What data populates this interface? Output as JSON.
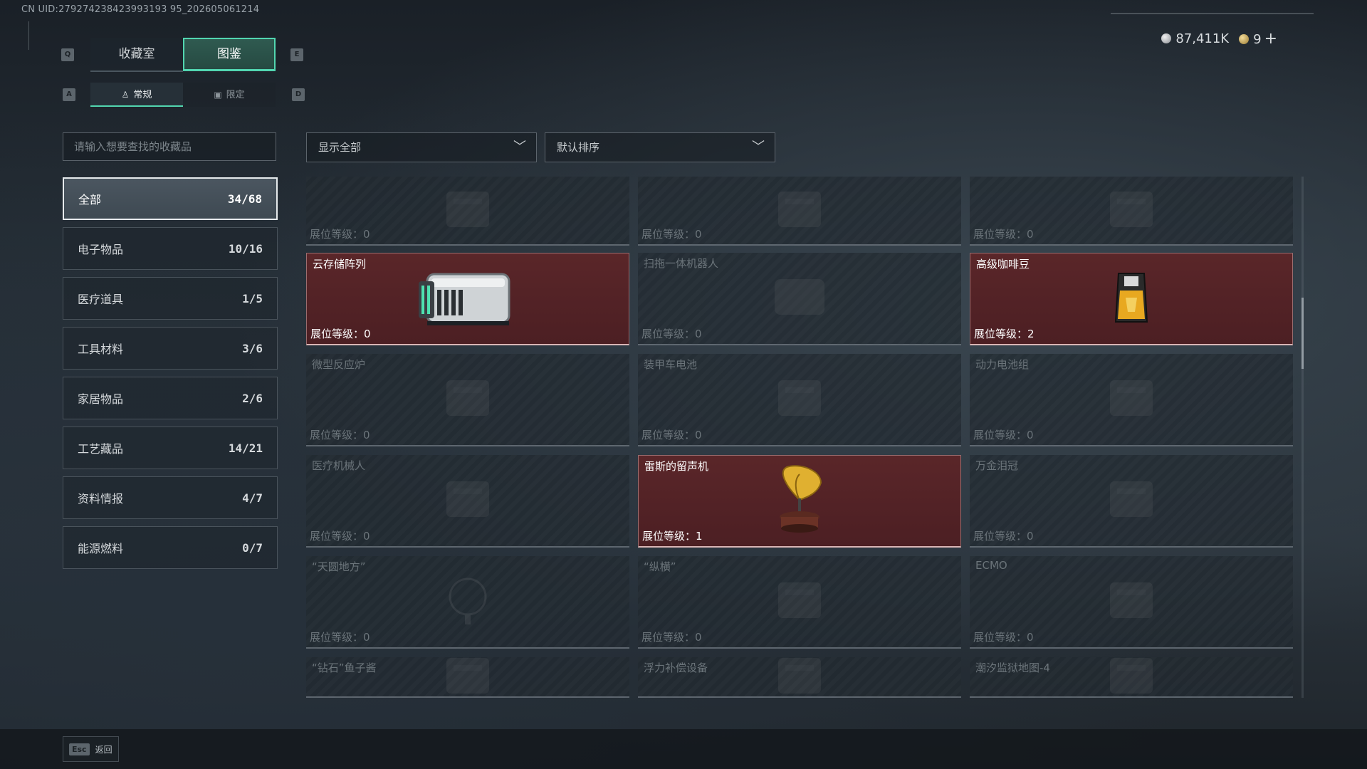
{
  "uid_text": "CN UID:279274238423993193 95_202605061214",
  "currency": {
    "coins": "87,411K",
    "tickets": "9",
    "plus": "+"
  },
  "keys": {
    "prev_tab": "Q",
    "next_tab": "E",
    "prev_sub": "A",
    "next_sub": "D"
  },
  "tabs": [
    {
      "label": "收藏室"
    },
    {
      "label": "图鉴"
    }
  ],
  "subtabs": [
    {
      "label": "常规"
    },
    {
      "label": "限定"
    }
  ],
  "search": {
    "placeholder": "请输入想要查找的收藏品"
  },
  "filters": {
    "show": "显示全部",
    "sort": "默认排序"
  },
  "categories": [
    {
      "label": "全部",
      "count": "34/68"
    },
    {
      "label": "电子物品",
      "count": "10/16"
    },
    {
      "label": "医疗道具",
      "count": "1/5"
    },
    {
      "label": "工具材料",
      "count": "3/6"
    },
    {
      "label": "家居物品",
      "count": "2/6"
    },
    {
      "label": "工艺藏品",
      "count": "14/21"
    },
    {
      "label": "资料情报",
      "count": "4/7"
    },
    {
      "label": "能源燃料",
      "count": "0/7"
    }
  ],
  "level_prefix": "展位等级：",
  "items": [
    {
      "name": "",
      "level": "0",
      "owned": false,
      "icon": "blank-icon"
    },
    {
      "name": "",
      "level": "0",
      "owned": false,
      "icon": "device-icon"
    },
    {
      "name": "",
      "level": "0",
      "owned": false,
      "icon": "vacuum-icon"
    },
    {
      "name": "云存储阵列",
      "level": "0",
      "owned": true,
      "icon": "storage-array-icon"
    },
    {
      "name": "扫拖一体机器人",
      "level": "0",
      "owned": false,
      "icon": "robot-icon"
    },
    {
      "name": "高级咖啡豆",
      "level": "2",
      "owned": true,
      "icon": "coffee-bag-icon"
    },
    {
      "name": "微型反应炉",
      "level": "0",
      "owned": false,
      "icon": "reactor-icon"
    },
    {
      "name": "装甲车电池",
      "level": "0",
      "owned": false,
      "icon": "battery-icon"
    },
    {
      "name": "动力电池组",
      "level": "0",
      "owned": false,
      "icon": "battery-pack-icon"
    },
    {
      "name": "医疗机械人",
      "level": "0",
      "owned": false,
      "icon": "med-robot-icon"
    },
    {
      "name": "雷斯的留声机",
      "level": "1",
      "owned": true,
      "icon": "gramophone-icon"
    },
    {
      "name": "万金泪冠",
      "level": "0",
      "owned": false,
      "icon": "crown-icon"
    },
    {
      "name": "“天圆地方”",
      "level": "0",
      "owned": false,
      "icon": "globe-icon"
    },
    {
      "name": "“纵横”",
      "level": "0",
      "owned": false,
      "icon": "board-icon"
    },
    {
      "name": "ECMO",
      "level": "0",
      "owned": false,
      "icon": "ecmo-icon"
    },
    {
      "name": "“钻石”鱼子酱",
      "level": "",
      "owned": false,
      "icon": "caviar-icon"
    },
    {
      "name": "浮力补偿设备",
      "level": "",
      "owned": false,
      "icon": "bcd-icon"
    },
    {
      "name": "潮汐监狱地图-4",
      "level": "",
      "owned": false,
      "icon": "map-icon"
    }
  ],
  "footer": {
    "esc_key": "Esc",
    "back": "返回"
  }
}
